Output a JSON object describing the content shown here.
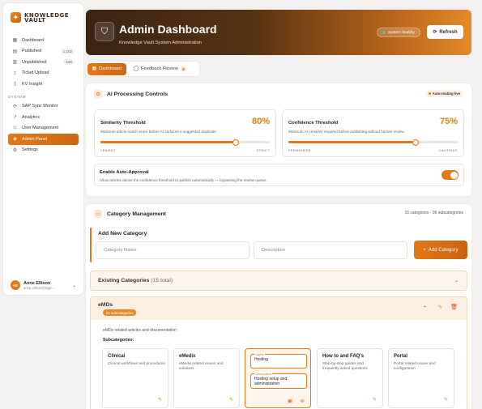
{
  "brand": {
    "logo": "Knowledge Vault"
  },
  "sidebar": {
    "items": [
      {
        "label": "Dashboard",
        "icon": "grid-icon"
      },
      {
        "label": "Published",
        "icon": "document-icon",
        "badge": "1,102"
      },
      {
        "label": "Unpublished",
        "icon": "draft-icon",
        "badge": "158"
      },
      {
        "label": "Ticket Upload",
        "icon": "upload-icon"
      },
      {
        "label": "KV Insight",
        "icon": "book-icon"
      }
    ],
    "system_label": "SYSTEM",
    "system_items": [
      {
        "label": "SAP Sync Monitor",
        "icon": "sync-icon"
      },
      {
        "label": "Analytics",
        "icon": "chart-icon"
      },
      {
        "label": "User Management",
        "icon": "users-icon"
      },
      {
        "label": "Admin Panel",
        "icon": "shield-icon",
        "active": true
      },
      {
        "label": "Settings",
        "icon": "gear-icon"
      }
    ],
    "user": {
      "initials": "AE",
      "name": "Anne Ellison",
      "email": "anne.ellison@sigm..."
    }
  },
  "header": {
    "title": "Admin Dashboard",
    "subtitle": "Knowledge Vault System Administration",
    "health": "System healthy",
    "refresh": "Refresh"
  },
  "tabs": [
    {
      "label": "Dashboard",
      "active": true
    },
    {
      "label": "Feedback Review",
      "count": "6"
    }
  ],
  "ai": {
    "title": "AI Processing Controls",
    "live": "Auto-routing live",
    "similarity": {
      "title": "Similarity Threshold",
      "value": "80%",
      "fraction": 0.8,
      "desc": "Minimum article match score before AI surfaces a suggested duplicate.",
      "left": "LENIENT",
      "right": "STRICT"
    },
    "confidence": {
      "title": "Confidence Threshold",
      "value": "75%",
      "fraction": 0.75,
      "desc": "Minimum AI certainty required before publishing without human review.",
      "left": "PERMISSIVE",
      "right": "CAUTIOUS"
    },
    "auto": {
      "title": "Enable Auto-Approval",
      "desc": "Allow articles above the confidence threshold to publish automatically — bypassing the review queue.",
      "enabled": true
    }
  },
  "catman": {
    "title": "Category Management",
    "summary": "15 categories · 96 subcategories",
    "new_title": "Add New Category",
    "name_placeholder": "Category Name",
    "desc_placeholder": "Description",
    "add_button": "Add Category",
    "existing_title": "Existing Categories",
    "existing_count": "(15 total)",
    "emds": {
      "name": "eMDs",
      "badge": "21 subcategories",
      "desc": "eMDs related articles and documentation",
      "sub_label": "Subcategories:",
      "subs": [
        {
          "name": "Clinical",
          "desc": "Clinical workflows and procedures"
        },
        {
          "name": "eMedix",
          "desc": "eMedix related issues and solutions"
        },
        {
          "name": "Hosting",
          "desc": "Hosting setup and administration"
        },
        {
          "name": "How to and FAQ's",
          "desc": "Step-by-step guides and frequently asked questions"
        },
        {
          "name": "Portal",
          "desc": "Portal related issues and configuration"
        }
      ],
      "edit_labels": {
        "name": "Name",
        "description": "Description"
      }
    }
  }
}
